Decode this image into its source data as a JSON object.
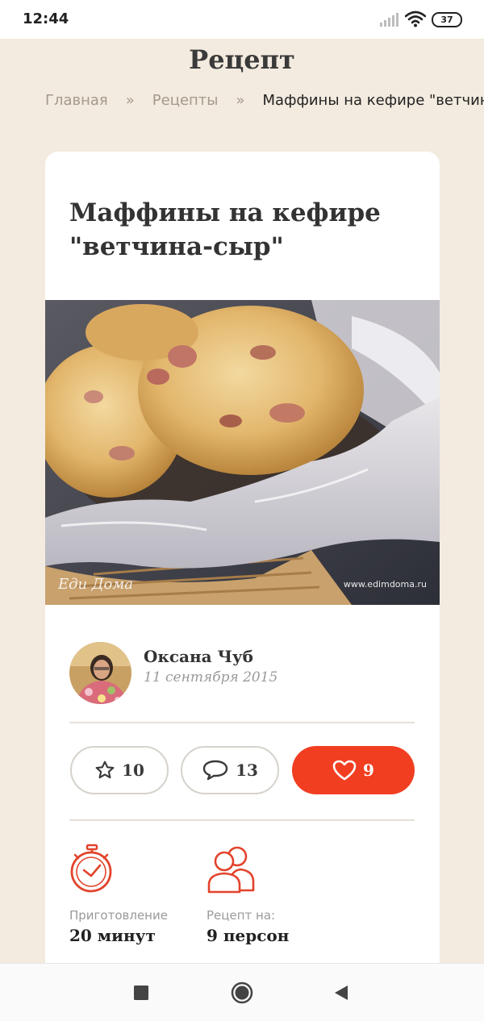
{
  "status_bar": {
    "time": "12:44",
    "battery": "37"
  },
  "header": {
    "title": "Рецепт"
  },
  "breadcrumb": [
    {
      "label": "Главная"
    },
    {
      "label": "Рецепты"
    },
    {
      "label": "Маффины на кефире \"ветчина-сыр\""
    }
  ],
  "breadcrumb_separator": "»",
  "recipe": {
    "title": "Маффины на кефире \"ветчина-сыр\"",
    "photo_watermark_left": "Еди Дома",
    "photo_watermark_right": "www.edimdoma.ru",
    "author": {
      "name": "Оксана Чуб",
      "date": "11 сентября 2015"
    },
    "stats": {
      "favorites": "10",
      "comments": "13",
      "likes": "9"
    },
    "info": {
      "cook_time_label": "Приготовление",
      "cook_time_value": "20 минут",
      "servings_label": "Рецепт на:",
      "servings_value": "9 персон"
    }
  },
  "colors": {
    "accent": "#f13e21",
    "background": "#f3ebdf",
    "card": "#ffffff"
  }
}
